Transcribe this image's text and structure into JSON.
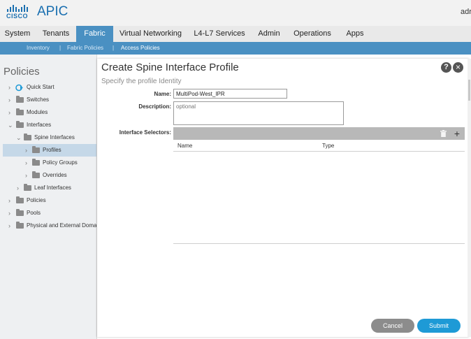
{
  "header": {
    "logo_text": "CISCO",
    "app_name": "APIC",
    "user": "adr"
  },
  "tabs": [
    {
      "label": "System"
    },
    {
      "label": "Tenants"
    },
    {
      "label": "Fabric",
      "active": true
    },
    {
      "label": "Virtual Networking"
    },
    {
      "label": "L4-L7 Services"
    },
    {
      "label": "Admin"
    },
    {
      "label": "Operations"
    },
    {
      "label": "Apps"
    }
  ],
  "subnav": [
    {
      "label": "Inventory"
    },
    {
      "label": "Fabric Policies"
    },
    {
      "label": "Access Policies",
      "active": true
    }
  ],
  "sidebar": {
    "title": "Policies",
    "items": [
      {
        "label": "Quick Start",
        "icon": "quick-start-icon",
        "expanded": false
      },
      {
        "label": "Switches",
        "icon": "folder-icon",
        "expanded": false
      },
      {
        "label": "Modules",
        "icon": "folder-icon",
        "expanded": false
      },
      {
        "label": "Interfaces",
        "icon": "folder-icon",
        "expanded": true
      },
      {
        "label": "Spine Interfaces",
        "icon": "folder-icon",
        "expanded": true
      },
      {
        "label": "Profiles",
        "icon": "folder-icon",
        "expanded": false,
        "selected": true
      },
      {
        "label": "Policy Groups",
        "icon": "folder-icon",
        "expanded": false
      },
      {
        "label": "Overrides",
        "icon": "folder-icon",
        "expanded": false
      },
      {
        "label": "Leaf Interfaces",
        "icon": "folder-icon",
        "expanded": false
      },
      {
        "label": "Policies",
        "icon": "folder-icon",
        "expanded": false
      },
      {
        "label": "Pools",
        "icon": "folder-icon",
        "expanded": false
      },
      {
        "label": "Physical and External Doma",
        "icon": "folder-icon",
        "expanded": false
      }
    ]
  },
  "dialog": {
    "title": "Create Spine Interface Profile",
    "subtitle": "Specify the profile Identity",
    "help_label": "?",
    "close_label": "×",
    "name_label": "Name:",
    "name_value": "MultiPod-West_IPR",
    "description_label": "Description:",
    "description_placeholder": "optional",
    "selectors_label": "Interface Selectors:",
    "add_label": "+",
    "columns": [
      "Name",
      "Type"
    ],
    "cancel_label": "Cancel",
    "submit_label": "Submit"
  },
  "colors": {
    "accent": "#4a90c2",
    "submit": "#1e9ad6",
    "cancel": "#8c8c8c",
    "brand": "#1a6fb0"
  }
}
